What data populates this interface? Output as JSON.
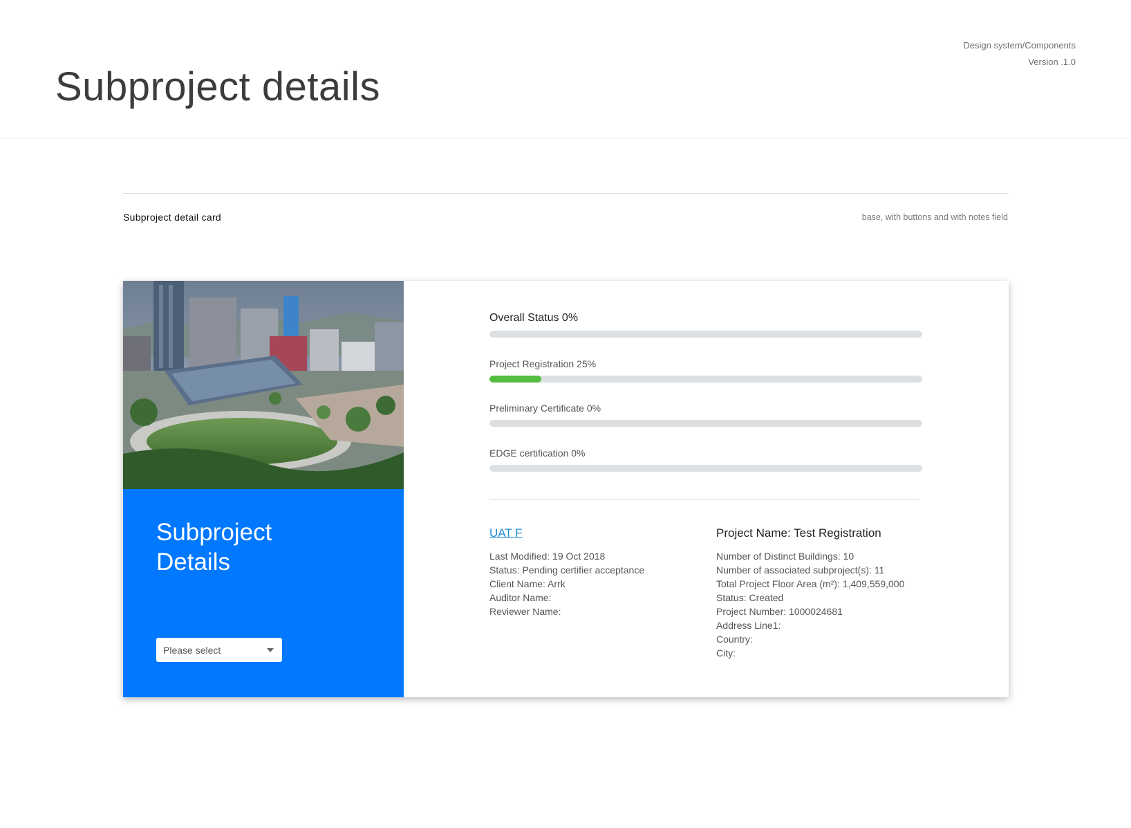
{
  "header": {
    "title": "Subproject details",
    "meta_line1": "Design system/Components",
    "meta_line2": "Version .1.0"
  },
  "section": {
    "title": "Subproject detail card",
    "note": "base, with buttons and with notes field"
  },
  "card": {
    "heading": "Subproject Details",
    "select": {
      "value": "Please select"
    },
    "progress": [
      {
        "label": "Overall Status 0%",
        "percent": 0
      },
      {
        "label": "Project Registration 25%",
        "percent": 25
      },
      {
        "label": "Preliminary Certificate 0%",
        "percent": 0
      },
      {
        "label": "EDGE certification 0%",
        "percent": 0
      }
    ],
    "left_column": {
      "link": "UAT F",
      "rows": [
        "Last Modified: 19 Oct 2018",
        "Status: Pending certifier acceptance",
        "Client Name: Arrk",
        "Auditor Name:",
        "Reviewer Name:"
      ]
    },
    "right_column": {
      "heading": "Project Name: Test Registration",
      "rows": [
        "Number of Distinct Buildings: 10",
        "Number of associated subproject(s): 11",
        "Total Project Floor Area (m²): 1,409,559,000",
        "Status: Created",
        "Project Number: 1000024681",
        "Address Line1:",
        "Country:",
        "City:"
      ]
    }
  },
  "colors": {
    "accent": "#0078ff",
    "progress_fill": "#54bd3f",
    "progress_track": "#dde0e2",
    "link": "#1b8bd4"
  }
}
